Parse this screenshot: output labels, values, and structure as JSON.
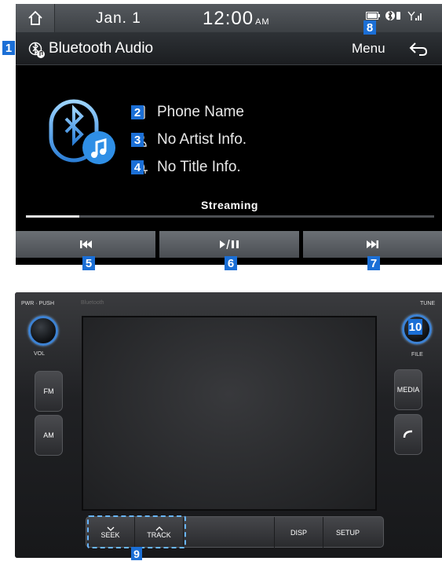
{
  "status_bar": {
    "home_icon": "home-icon",
    "date": "Jan.  1",
    "time": "12:00",
    "ampm": "AM",
    "icons": [
      "battery-icon",
      "bluetooth-phone-icon",
      "signal-icon"
    ]
  },
  "title_bar": {
    "title": "Bluetooth Audio",
    "menu_label": "Menu",
    "back_icon": "back-icon"
  },
  "track": {
    "phone_name": "Phone Name",
    "artist": "No Artist Info.",
    "title": "No Title Info."
  },
  "playback": {
    "status": "Streaming",
    "progress": 0.13
  },
  "controls": {
    "prev": "⏮",
    "play_pause": "▶/⏸",
    "next": "⏭"
  },
  "callouts": [
    "1",
    "2",
    "3",
    "4",
    "5",
    "6",
    "7",
    "8",
    "9",
    "10"
  ],
  "hardware": {
    "brand_label": "Bluetooth",
    "pwr_label": "PWR · PUSH",
    "vol_label": "VOL",
    "tune_label": "TUNE",
    "file_label": "FILE",
    "fm": "FM",
    "am": "AM",
    "media": "MEDIA",
    "phone_icon": "phone-icon",
    "seek": "SEEK",
    "track": "TRACK",
    "disp": "DISP",
    "setup": "SETUP"
  },
  "colors": {
    "callout_blue": "#1b6fd6",
    "highlight_blue": "#69b6ff",
    "knob_ring": "#3d82d3"
  }
}
